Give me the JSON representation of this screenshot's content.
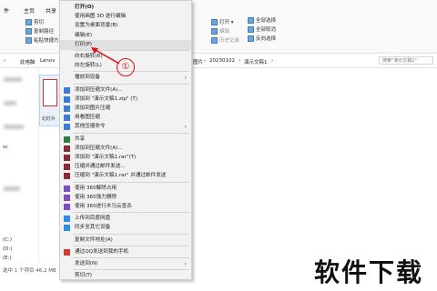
{
  "ribbon": {
    "tabs": [
      "件",
      "主页",
      "共享",
      "查看"
    ],
    "clipboard_buttons": [
      "剪切",
      "复制路径",
      "粘贴快捷方式"
    ],
    "open_group": [
      "打开",
      "编辑",
      "历史记录"
    ],
    "select_group": [
      "全部选择",
      "全部取消",
      "反向选择"
    ]
  },
  "address": {
    "left_crumbs": [
      "此电脑",
      "Lenov"
    ],
    "right_crumbs": [
      "图片",
      "20230102",
      "演示文稿1"
    ],
    "search_placeholder": "搜索\"演示文稿1\""
  },
  "nav": {
    "items": [
      "sc",
      "(C:)",
      "(D:)",
      "(E:)"
    ]
  },
  "file": {
    "name": "幻灯片"
  },
  "status": {
    "text": "选中 1 个项目  46.2 MB"
  },
  "menu": {
    "items": [
      {
        "label": "打开(O)",
        "icon": "",
        "sub": false,
        "bold": true
      },
      {
        "label": "使用画图 3D 进行编辑",
        "icon": "",
        "sub": false
      },
      {
        "label": "设置为桌面背景(B)",
        "icon": "",
        "sub": false
      },
      {
        "label": "编辑(E)",
        "icon": "",
        "sub": false
      },
      {
        "label": "打印(P)",
        "icon": "",
        "sub": false,
        "highlight": true
      },
      {
        "sep": true
      },
      {
        "label": "向右旋转(R)",
        "icon": "",
        "sub": false
      },
      {
        "label": "向左旋转(L)",
        "icon": "",
        "sub": false
      },
      {
        "sep": true
      },
      {
        "label": "播放到设备",
        "icon": "",
        "sub": true
      },
      {
        "sep": true
      },
      {
        "label": "添加到压缩文件(A)...",
        "icon": "zip-icon",
        "sub": false
      },
      {
        "label": "添加到 \"演示文稿1.zip\" (T)",
        "icon": "zip-icon",
        "sub": false
      },
      {
        "label": "添加到图片压缩",
        "icon": "zip-icon",
        "sub": false
      },
      {
        "label": "用看图压缩",
        "icon": "zip-icon",
        "sub": false
      },
      {
        "label": "其他压缩命令",
        "icon": "zip-icon",
        "sub": true
      },
      {
        "sep": true
      },
      {
        "label": "共享",
        "icon": "share-icon",
        "sub": false
      },
      {
        "label": "添加到压缩文件(A)...",
        "icon": "rar-icon",
        "sub": false
      },
      {
        "label": "添加到 \"演示文稿1.rar\"(T)",
        "icon": "rar-icon",
        "sub": false
      },
      {
        "label": "压缩并通过邮件发送...",
        "icon": "rar-icon",
        "sub": false
      },
      {
        "label": "压缩到 \"演示文稿1.rar\" 并通过邮件发送",
        "icon": "rar-icon",
        "sub": false
      },
      {
        "sep": true
      },
      {
        "label": "使用 360解除占用",
        "icon": "360-icon",
        "sub": false
      },
      {
        "label": "使用 360强力删除",
        "icon": "360-icon",
        "sub": false
      },
      {
        "label": "使用 360进行木马云查杀",
        "icon": "360-icon",
        "sub": false
      },
      {
        "sep": true
      },
      {
        "label": "上传到百度网盘",
        "icon": "cloud-icon",
        "sub": false
      },
      {
        "label": "同步至其它设备",
        "icon": "cloud-icon",
        "sub": false
      },
      {
        "sep": true
      },
      {
        "label": "复制文件地址(A)",
        "icon": "",
        "sub": false
      },
      {
        "sep": true
      },
      {
        "label": "通过QQ发送到我的手机",
        "icon": "qq-icon",
        "sub": false
      },
      {
        "sep": true
      },
      {
        "label": "发送到(N)",
        "icon": "",
        "sub": true
      },
      {
        "sep": true
      },
      {
        "label": "剪切(T)",
        "icon": "",
        "sub": false
      }
    ]
  },
  "annotation": {
    "step": "①"
  },
  "brand": {
    "text": "软件下载"
  },
  "colors": {
    "annotation": "#dd1111",
    "menu_bg": "#f2f2f2"
  }
}
